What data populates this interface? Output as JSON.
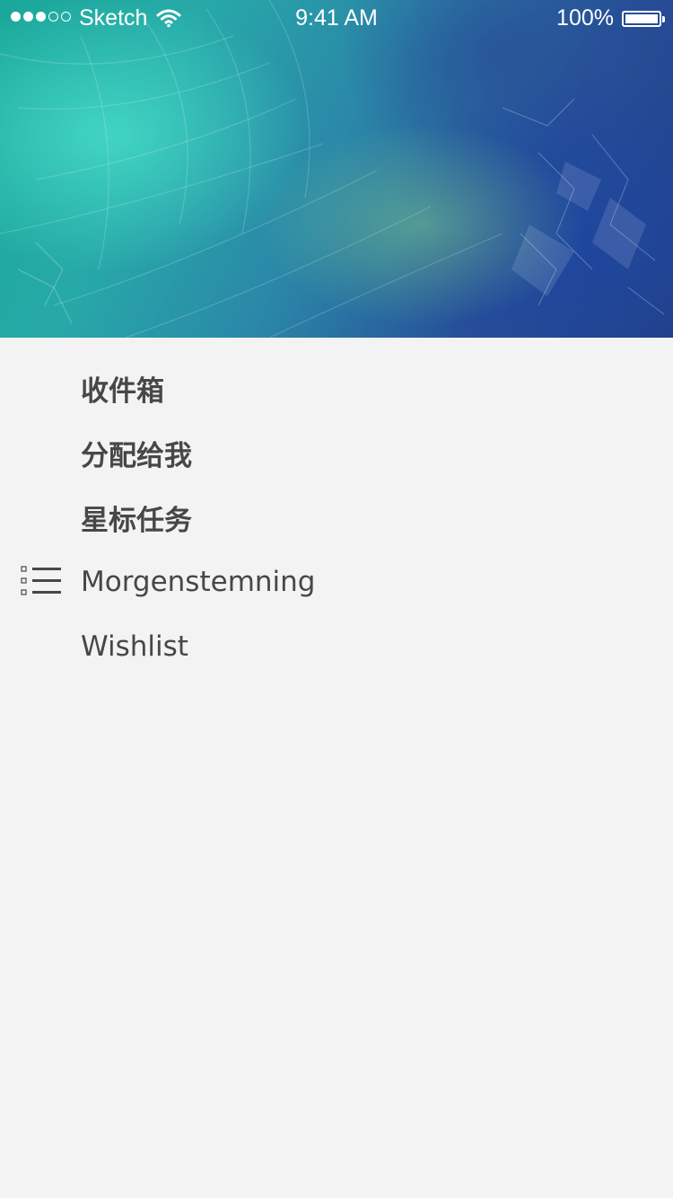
{
  "status_bar": {
    "carrier": "Sketch",
    "time": "9:41 AM",
    "battery": "100%",
    "signal_bars_filled": 3,
    "signal_bars_total": 5,
    "icons": [
      "signal-dots-icon",
      "wifi-icon",
      "battery-icon"
    ]
  },
  "header": {
    "image": "frosted-crystal-teal-blue-background"
  },
  "menu": {
    "items": [
      {
        "label": "收件箱"
      },
      {
        "label": "分配给我"
      },
      {
        "label": "星标任务"
      },
      {
        "label": "Morgenstemning",
        "icon": "list-icon"
      },
      {
        "label": "Wishlist"
      }
    ]
  },
  "colors": {
    "background": "#f3f3f3",
    "text": "#474747",
    "status_text": "#ffffff"
  }
}
